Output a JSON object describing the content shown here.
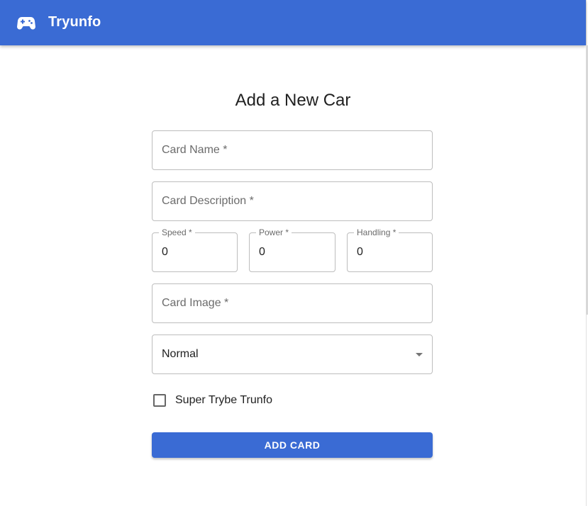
{
  "appbar": {
    "title": "Tryunfo",
    "logo_icon": "gamepad-icon",
    "color": "#3a6bd4"
  },
  "form": {
    "heading": "Add a New Car",
    "card_name": {
      "placeholder": "Card Name *",
      "value": ""
    },
    "card_description": {
      "placeholder": "Card Description *",
      "value": ""
    },
    "speed": {
      "label": "Speed *",
      "value": "0"
    },
    "power": {
      "label": "Power *",
      "value": "0"
    },
    "handling": {
      "label": "Handling *",
      "value": "0"
    },
    "card_image": {
      "placeholder": "Card Image *",
      "value": ""
    },
    "rarity": {
      "selected": "Normal"
    },
    "super_trunfo": {
      "label": "Super Trybe Trunfo",
      "checked": false
    },
    "submit_label": "ADD CARD"
  }
}
